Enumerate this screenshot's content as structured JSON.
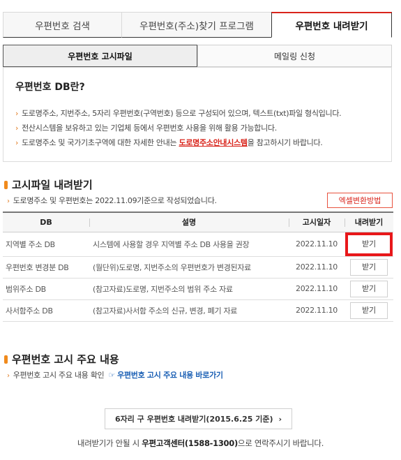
{
  "top_tabs": [
    {
      "label": "우편번호 검색"
    },
    {
      "label": "우편번호(주소)찾기 프로그램"
    },
    {
      "label": "우편번호 내려받기",
      "active": true
    }
  ],
  "sub_tabs": [
    {
      "label": "우편번호 고시파일",
      "active": true
    },
    {
      "label": "메일링 신청"
    }
  ],
  "info": {
    "title": "우편번호 DB란?",
    "bullet_glyph": "›",
    "line1": "도로명주소, 지번주소, 5자리 우편번호(구역번호) 등으로 구성되어 있으며, 텍스트(txt)파일 형식입니다.",
    "line2": "전산시스템을 보유하고 있는 기업체 등에서 우편번호 사용을 위해 활용 가능합니다.",
    "line3_pre": "도로명주소 및 국가기초구역에 대한 자세한 안내는 ",
    "line3_link": "도로명주소안내시스템",
    "line3_post": "을 참고하시기 바랍니다."
  },
  "download_section": {
    "title": "고시파일 내려받기",
    "desc": "도로명주소 및 우편번호는 2022.11.09기준으로 작성되었습니다.",
    "excel_button": "엑셀변환방법",
    "columns": {
      "db": "DB",
      "desc": "설명",
      "date": "고시일자",
      "dl": "내려받기"
    },
    "rows": [
      {
        "db": "지역별 주소 DB",
        "desc": "시스템에 사용할 경우 지역별 주소 DB 사용을 권장",
        "date": "2022.11.10",
        "btn": "받기"
      },
      {
        "db": "우편번호 변경분 DB",
        "desc": "(월단위)도로명, 지번주소의 우편번호가 변경된자료",
        "date": "2022.11.10",
        "btn": "받기"
      },
      {
        "db": "범위주소 DB",
        "desc": "(참고자료)도로명, 지번주소의 범위 주소 자료",
        "date": "2022.11.10",
        "btn": "받기"
      },
      {
        "db": "사서함주소 DB",
        "desc": "(참고자료)사서함 주소의 신규, 변경, 폐기 자료",
        "date": "2022.11.10",
        "btn": "받기"
      }
    ]
  },
  "notice_section": {
    "title": "우편번호 고시 주요 내용",
    "desc": "우편번호 고시 주요 내용 확인",
    "link_icon": "☞",
    "link": "우편번호 고시 주요 내용 바로가기"
  },
  "old_button": {
    "label": "6자리 구 우편번호 내려받기(2015.6.25 기준)",
    "chevron": "›"
  },
  "footer": {
    "pre": "내려받기가 안될 시 ",
    "bold": "우편고객센터(1588-1300)",
    "post": "으로 연락주시기 바랍니다."
  },
  "colors": {
    "accent_red": "#d9241b",
    "section_bar": "#f08a1c",
    "link_blue": "#1a5fb4",
    "highlight_box": "#e8171a"
  }
}
